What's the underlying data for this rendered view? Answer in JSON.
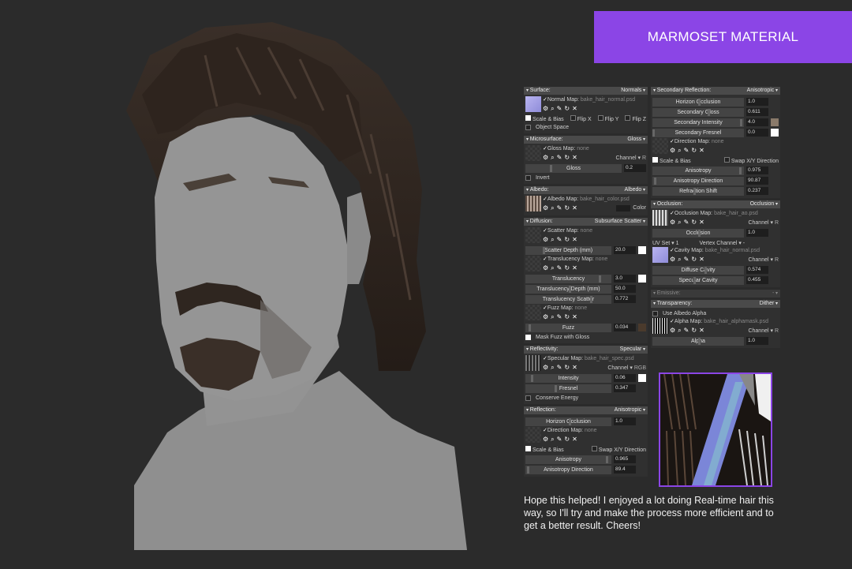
{
  "banner": {
    "title": "MARMOSET MATERIAL"
  },
  "caption": "Hope this helped! I enjoyed a lot doing Real-time hair this way, so I'll try and make the process more efficient and to get a better result. Cheers!",
  "left": {
    "surface": {
      "title": "Surface:",
      "mode": "Normals",
      "map_label": "Normal Map:",
      "map_file": "bake_hair_normal.psd",
      "opt_scale_bias": "Scale & Bias",
      "opt_flipx": "Flip X",
      "opt_flipy": "Flip Y",
      "opt_flipz": "Flip Z",
      "opt_object_space": "Object Space"
    },
    "micro": {
      "title": "Microsurface:",
      "mode": "Gloss",
      "map_label": "Gloss Map:",
      "map_file": "none",
      "channel": "Channel",
      "channel_val": "R",
      "slider": "Gloss",
      "value": "0.2",
      "opt_invert": "Invert"
    },
    "albedo": {
      "title": "Albedo:",
      "mode": "Albedo",
      "map_label": "Albedo Map:",
      "map_file": "bake_hair_color.psd",
      "color_label": "Color"
    },
    "diffusion": {
      "title": "Diffusion:",
      "mode": "Subsurface Scatter",
      "scatter_label": "Scatter Map:",
      "scatter_file": "none",
      "scatter_depth": "Scatter Depth (mm)",
      "scatter_depth_val": "20.0",
      "transl_label": "Translucency Map:",
      "transl_file": "none",
      "translucency": "Translucency",
      "translucency_val": "3.0",
      "transl_depth": "Translucency Depth (mm)",
      "transl_depth_val": "50.0",
      "transl_scatter": "Translucency Scatter",
      "transl_scatter_val": "0.772",
      "fuzz_label": "Fuzz Map:",
      "fuzz_file": "none",
      "fuzz": "Fuzz",
      "fuzz_val": "0.034",
      "opt_mask_fuzz": "Mask Fuzz with Gloss"
    },
    "reflectivity": {
      "title": "Reflectivity:",
      "mode": "Specular",
      "map_label": "Specular Map:",
      "map_file": "bake_hair_spec.psd",
      "channel": "Channel",
      "channel_val": "RGB",
      "intensity": "Intensity",
      "intensity_val": "0.06",
      "fresnel": "Fresnel",
      "fresnel_val": "0.347",
      "opt_conserve": "Conserve Energy"
    },
    "reflection": {
      "title": "Reflection:",
      "mode": "Anisotropic",
      "horizon": "Horizon Occlusion",
      "horizon_val": "1.0",
      "map_label": "Direction Map:",
      "map_file": "none",
      "opt_scale_bias": "Scale & Bias",
      "opt_swap": "Swap X/Y Direction",
      "aniso": "Anisotropy",
      "aniso_val": "0.965",
      "aniso_dir": "Anisotropy Direction",
      "aniso_dir_val": "89.4"
    }
  },
  "right": {
    "secondary": {
      "title": "Secondary Reflection:",
      "mode": "Anisotropic",
      "horizon": "Horizon Occlusion",
      "horizon_val": "1.0",
      "gloss": "Secondary Gloss",
      "gloss_val": "0.611",
      "intensity": "Secondary Intensity",
      "intensity_val": "4.0",
      "fresnel": "Secondary Fresnel",
      "fresnel_val": "0.0",
      "map_label": "Direction Map:",
      "map_file": "none",
      "opt_scale_bias": "Scale & Bias",
      "opt_swap": "Swap X/Y Direction",
      "aniso": "Anisotropy",
      "aniso_val": "0.975",
      "aniso_dir": "Anisotropy Direction",
      "aniso_dir_val": "90.87",
      "refr": "Refraction Shift",
      "refr_val": "0.237"
    },
    "occlusion": {
      "title": "Occlusion:",
      "mode": "Occlusion",
      "map_label": "Occlusion Map:",
      "map_file": "bake_hair_ao.psd",
      "channel": "Channel",
      "channel_val": "R",
      "occ": "Occlusion",
      "occ_val": "1.0",
      "uvset": "UV Set",
      "uvset_val": "1",
      "vchan": "Vertex Channel",
      "vchan_val": "-",
      "cavity_label": "Cavity Map:",
      "cavity_file": "bake_hair_normal.psd",
      "cavity_chan": "Channel",
      "cavity_chan_val": "R",
      "diff_cav": "Diffuse Cavity",
      "diff_cav_val": "0.574",
      "spec_cav": "Specular Cavity",
      "spec_cav_val": "0.455"
    },
    "emissive": {
      "title": "Emissive:",
      "mode": "-"
    },
    "transparency": {
      "title": "Transparency:",
      "mode": "Dither",
      "opt_use_albedo": "Use Albedo Alpha",
      "map_label": "Alpha Map:",
      "map_file": "bake_hair_alphamask.psd",
      "channel": "Channel",
      "channel_val": "R",
      "alpha": "Alpha",
      "alpha_val": "1.0"
    }
  }
}
